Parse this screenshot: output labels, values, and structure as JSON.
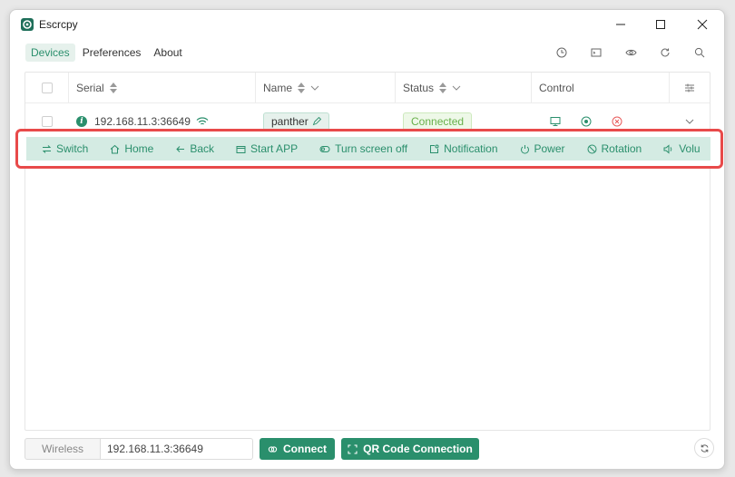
{
  "window": {
    "title": "Escrcpy",
    "minimize_icon": "minimize-icon",
    "maximize_icon": "maximize-icon",
    "close_icon": "close-icon"
  },
  "nav": {
    "tabs": [
      {
        "label": "Devices",
        "active": true
      },
      {
        "label": "Preferences",
        "active": false
      },
      {
        "label": "About",
        "active": false
      }
    ]
  },
  "toolbar_icons": [
    "clock-icon",
    "terminal-icon",
    "eye-icon",
    "refresh-icon",
    "search-icon"
  ],
  "table": {
    "headers": {
      "serial": "Serial",
      "name": "Name",
      "status": "Status",
      "control": "Control"
    },
    "rows": [
      {
        "serial": "192.168.11.3:36649",
        "name": "panther",
        "status": "Connected"
      }
    ]
  },
  "actions": [
    {
      "label": "Switch",
      "icon": "switch-icon"
    },
    {
      "label": "Home",
      "icon": "home-icon"
    },
    {
      "label": "Back",
      "icon": "back-icon"
    },
    {
      "label": "Start APP",
      "icon": "app-icon"
    },
    {
      "label": "Turn screen off",
      "icon": "screen-off-icon"
    },
    {
      "label": "Notification",
      "icon": "notification-icon"
    },
    {
      "label": "Power",
      "icon": "power-icon"
    },
    {
      "label": "Rotation",
      "icon": "rotation-icon"
    },
    {
      "label": "Volu",
      "icon": "volume-icon"
    }
  ],
  "footer": {
    "wireless_label": "Wireless",
    "address_value": "192.168.11.3:36649",
    "connect_label": "Connect",
    "qr_label": "QR Code Connection"
  },
  "colors": {
    "accent": "#2a8f6c",
    "highlight_border": "#e84a4a",
    "connected_text": "#67b04a"
  }
}
